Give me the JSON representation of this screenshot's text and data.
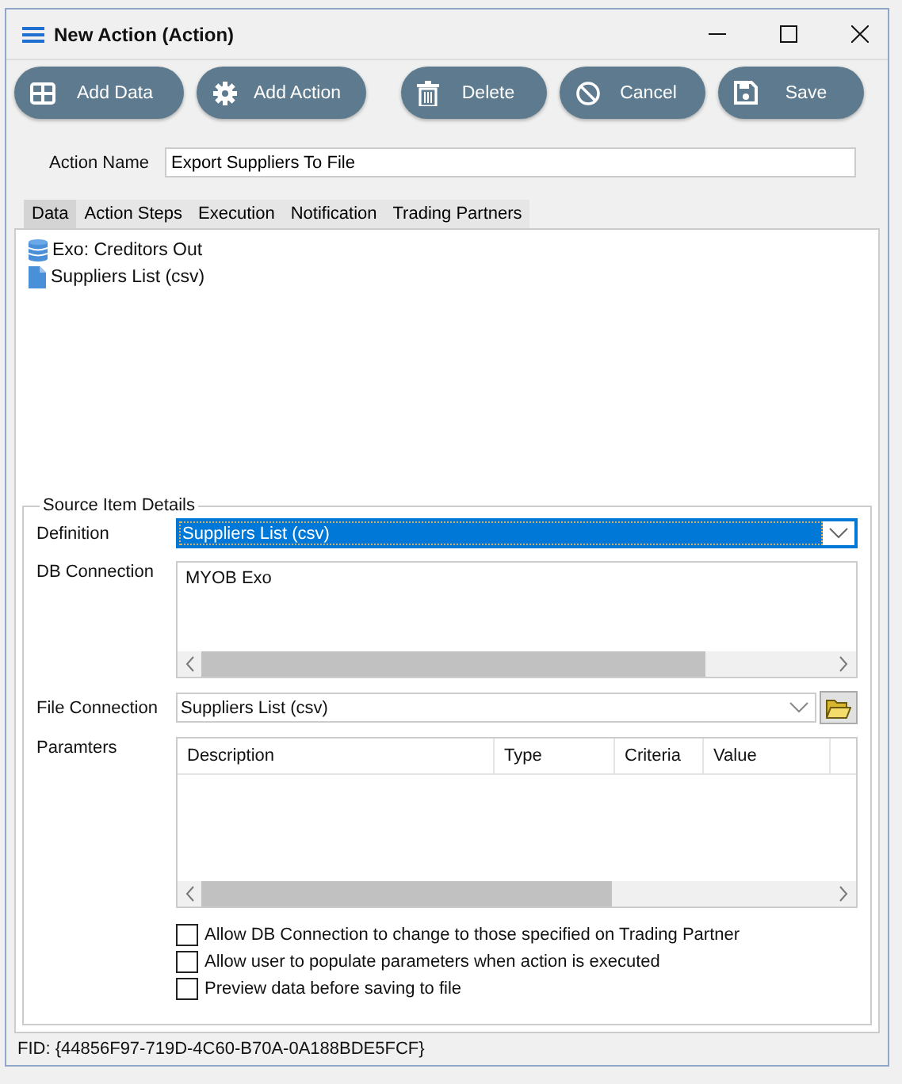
{
  "window": {
    "title": "New Action (Action)"
  },
  "toolbar": [
    {
      "label": "Add Data",
      "kind": "table"
    },
    {
      "label": "Add Action",
      "kind": "gear"
    },
    {
      "label": "Delete",
      "kind": "trash"
    },
    {
      "label": "Cancel",
      "kind": "cancel"
    },
    {
      "label": "Save",
      "kind": "save"
    }
  ],
  "action_name": {
    "label": "Action Name",
    "value": "Export Suppliers To File"
  },
  "tabs": [
    {
      "label": "Data",
      "selected": true
    },
    {
      "label": "Action Steps",
      "selected": false
    },
    {
      "label": "Execution",
      "selected": false
    },
    {
      "label": "Notification",
      "selected": false
    },
    {
      "label": "Trading Partners",
      "selected": false
    }
  ],
  "tree": [
    {
      "label": "Exo: Creditors Out",
      "kind": "database"
    },
    {
      "label": "Suppliers List (csv)",
      "kind": "file"
    }
  ],
  "source_details": {
    "title": "Source Item Details",
    "definition": {
      "label": "Definition",
      "value": "Suppliers List (csv)"
    },
    "db_connection": {
      "label": "DB Connection",
      "items": [
        "MYOB Exo"
      ]
    },
    "file_connection": {
      "label": "File Connection",
      "value": "Suppliers List (csv)"
    },
    "parameters": {
      "label": "Paramters",
      "columns": [
        "Description",
        "Type",
        "Criteria",
        "Value"
      ]
    },
    "options": [
      {
        "label": "Allow DB Connection to change to those specified on Trading Partner",
        "checked": false
      },
      {
        "label": "Allow user to populate parameters when action is executed",
        "checked": false
      },
      {
        "label": "Preview data before saving to file",
        "checked": false
      }
    ]
  },
  "status_bar": {
    "text": "FID: {44856F97-719D-4C60-B70A-0A188BDE5FCF}"
  }
}
